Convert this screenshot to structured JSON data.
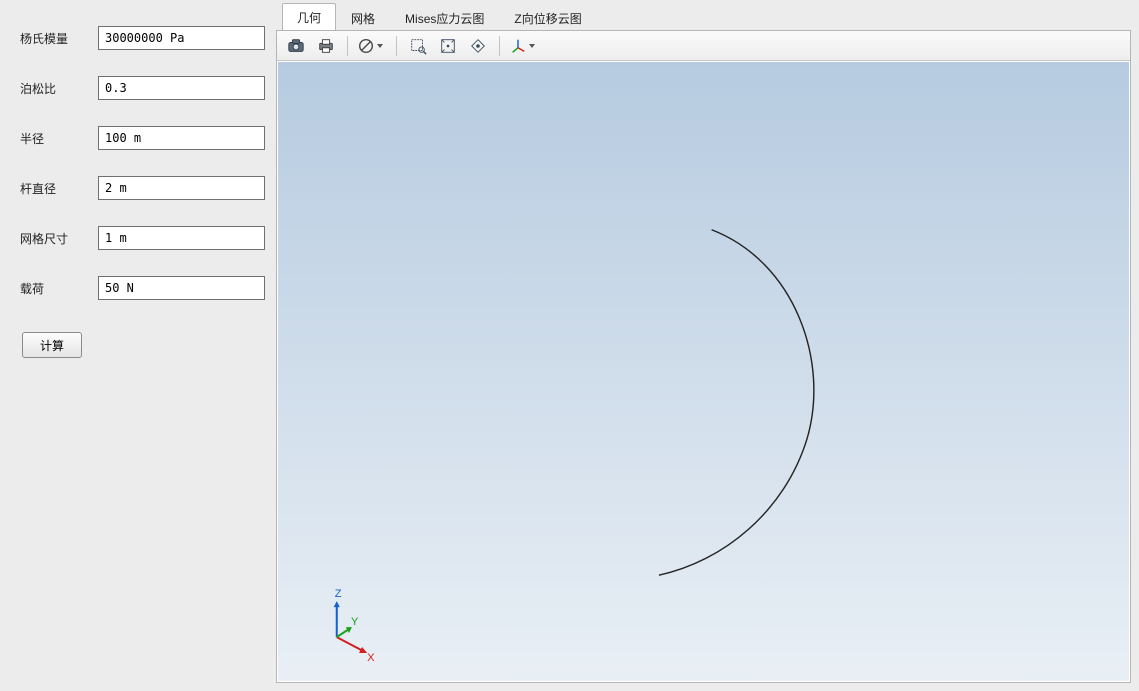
{
  "form": {
    "fields": [
      {
        "label": "杨氏模量",
        "value": "30000000 Pa",
        "name": "youngs-modulus"
      },
      {
        "label": "泊松比",
        "value": "0.3",
        "name": "poisson-ratio"
      },
      {
        "label": "半径",
        "value": "100 m",
        "name": "radius"
      },
      {
        "label": "杆直径",
        "value": "2 m",
        "name": "rod-diameter"
      },
      {
        "label": "网格尺寸",
        "value": "1 m",
        "name": "mesh-size"
      },
      {
        "label": "载荷",
        "value": "50 N",
        "name": "load"
      }
    ],
    "calculate_label": "计算"
  },
  "tabs": [
    {
      "label": "几何",
      "active": true
    },
    {
      "label": "网格",
      "active": false
    },
    {
      "label": "Mises应力云图",
      "active": false
    },
    {
      "label": "Z向位移云图",
      "active": false
    }
  ],
  "toolbar": {
    "icons": [
      "camera-icon",
      "print-icon",
      "_sep",
      "clear-dropdown-icon",
      "_sep",
      "zoom-box-icon",
      "fit-view-icon",
      "rotate-view-icon",
      "_sep",
      "axes-dropdown-icon"
    ]
  },
  "triad": {
    "x_label": "X",
    "y_label": "Y",
    "z_label": "Z"
  }
}
